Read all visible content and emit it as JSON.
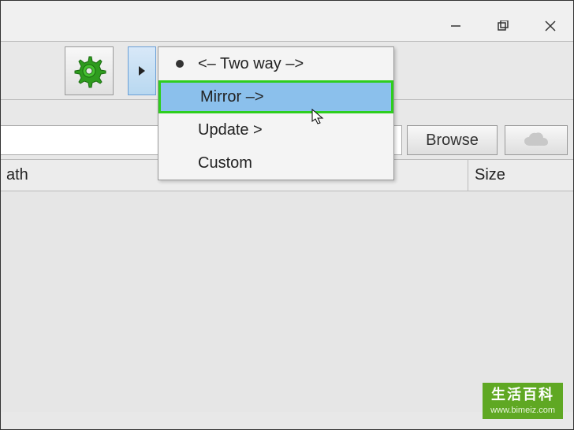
{
  "titlebar": {
    "minimize": "—",
    "maximize": "▢",
    "close": "✕"
  },
  "toolbar": {
    "gear_icon": "gear",
    "dropdown_arrow": "▶"
  },
  "sync_menu": {
    "items": [
      {
        "label": "<– Two way –>",
        "bullet": true,
        "selected": false
      },
      {
        "label": "Mirror –>",
        "bullet": false,
        "selected": true
      },
      {
        "label": "Update >",
        "bullet": false,
        "selected": false
      },
      {
        "label": "Custom",
        "bullet": false,
        "selected": false
      }
    ]
  },
  "panel": {
    "browse_label": "Browse",
    "cloud_icon": "cloud"
  },
  "columns": {
    "path": "ath",
    "size": "Size"
  },
  "watermark": {
    "title": "生活百科",
    "url": "www.bimeiz.com"
  }
}
